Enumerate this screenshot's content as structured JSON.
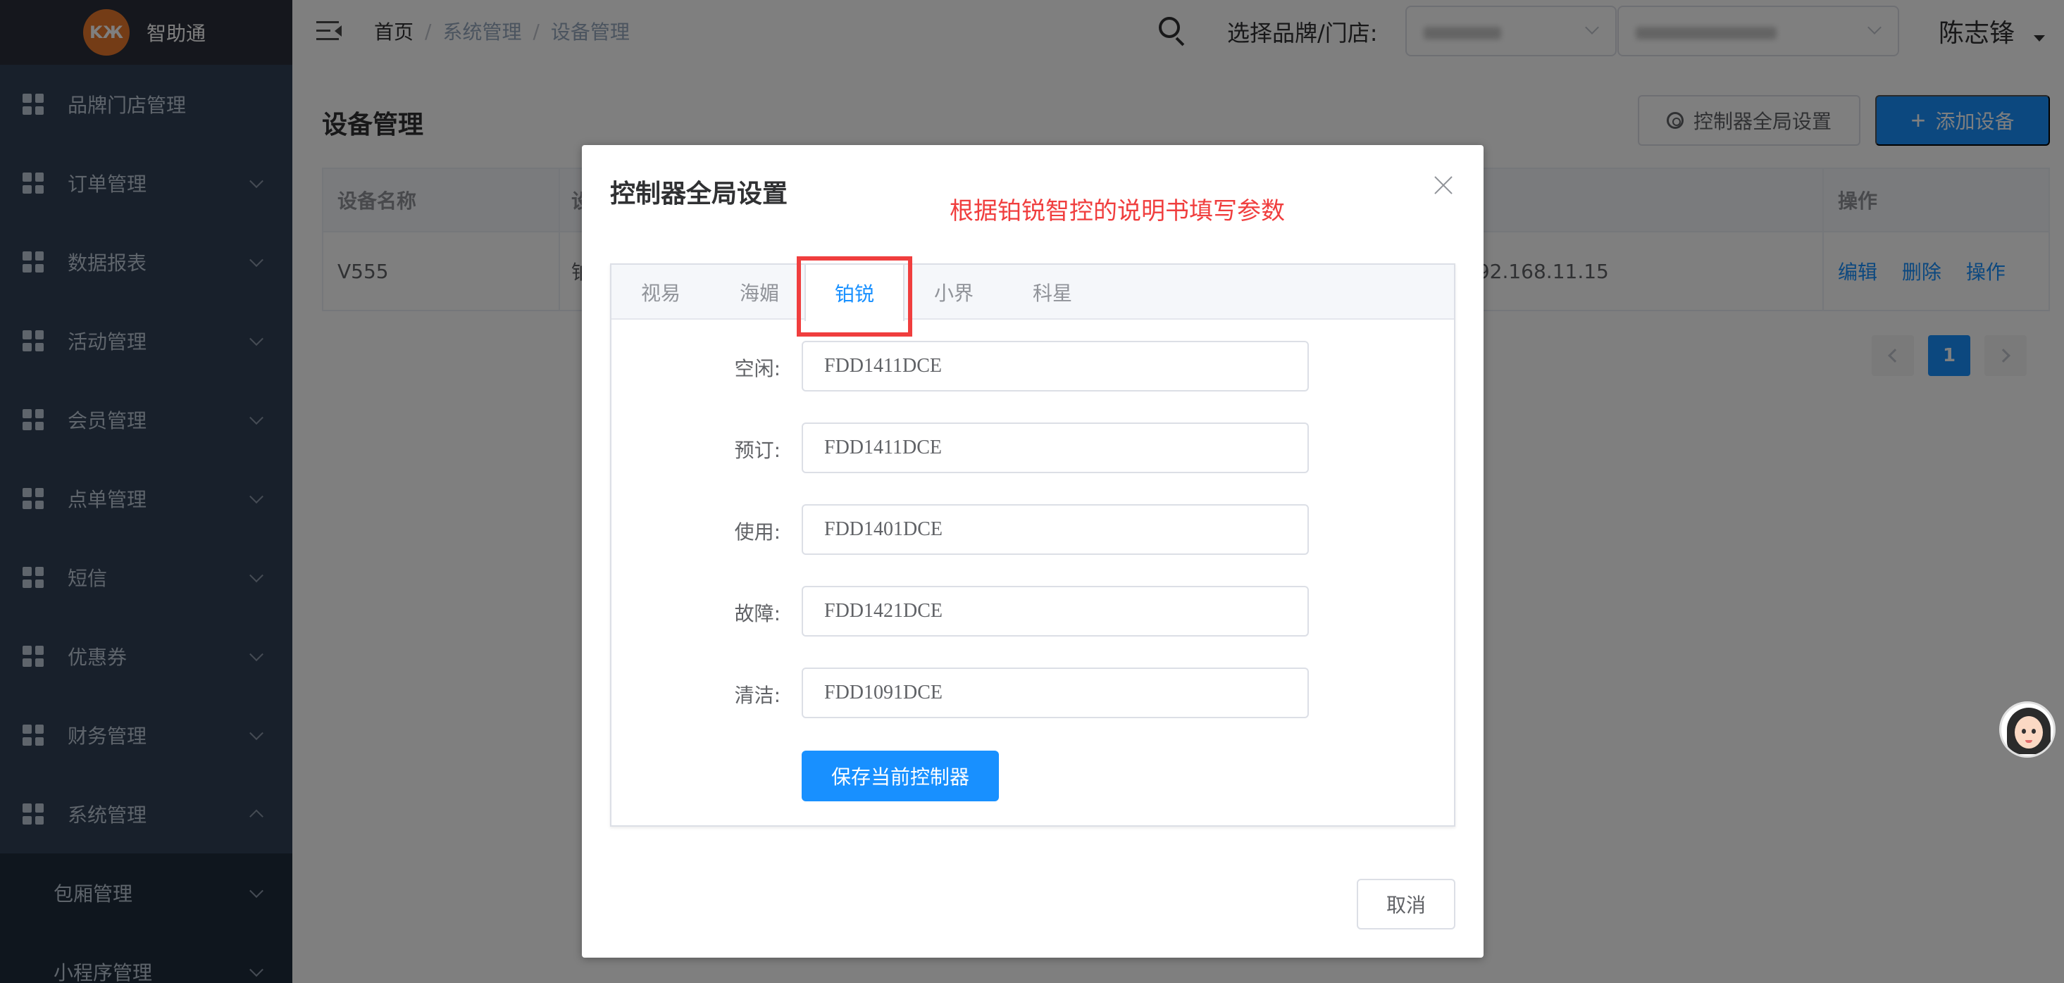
{
  "app": {
    "logo_text": "KЖ",
    "name": "智助通"
  },
  "sidebar": {
    "items": [
      {
        "label": "品牌门店管理",
        "has_arrow": false
      },
      {
        "label": "订单管理",
        "has_arrow": true
      },
      {
        "label": "数据报表",
        "has_arrow": true
      },
      {
        "label": "活动管理",
        "has_arrow": true
      },
      {
        "label": "会员管理",
        "has_arrow": true
      },
      {
        "label": "点单管理",
        "has_arrow": true
      },
      {
        "label": "短信",
        "has_arrow": true
      },
      {
        "label": "优惠券",
        "has_arrow": true
      },
      {
        "label": "财务管理",
        "has_arrow": true
      },
      {
        "label": "系统管理",
        "has_arrow": true,
        "expanded": true
      }
    ],
    "sub_items": [
      {
        "label": "包厢管理"
      },
      {
        "label": "小程序管理"
      }
    ]
  },
  "header": {
    "breadcrumb": [
      "首页",
      "系统管理",
      "设备管理"
    ],
    "breadcrumb_sep": "/",
    "store_label": "选择品牌/门店:",
    "user_name": "陈志锋"
  },
  "page": {
    "title": "设备管理",
    "global_settings_button": "控制器全局设置",
    "add_device_button": "添加设备",
    "table": {
      "headers": {
        "name": "设备名称",
        "second": "设",
        "operations": "操作"
      },
      "rows": [
        {
          "name": "V555",
          "second": "铂",
          "ip": "192.168.11.15",
          "ops": [
            "编辑",
            "删除",
            "操作"
          ]
        }
      ]
    },
    "pagination": {
      "current_page": "1"
    }
  },
  "dialog": {
    "title": "控制器全局设置",
    "annotation": "根据铂锐智控的说明书填写参数",
    "tabs": [
      "视易",
      "海媚",
      "铂锐",
      "小界",
      "科星"
    ],
    "active_tab": "铂锐",
    "fields": [
      {
        "label": "空闲:",
        "value": "FDD1411DCE"
      },
      {
        "label": "预订:",
        "value": "FDD1411DCE"
      },
      {
        "label": "使用:",
        "value": "FDD1401DCE"
      },
      {
        "label": "故障:",
        "value": "FDD1421DCE"
      },
      {
        "label": "清洁:",
        "value": "FDD1091DCE"
      }
    ],
    "save_button": "保存当前控制器",
    "cancel_button": "取消"
  },
  "colors": {
    "primary": "#1890ff",
    "annotation_red": "#f03e3e",
    "sidebar_bg": "#304156",
    "overlay": "rgba(0,0,0,0.5)"
  }
}
